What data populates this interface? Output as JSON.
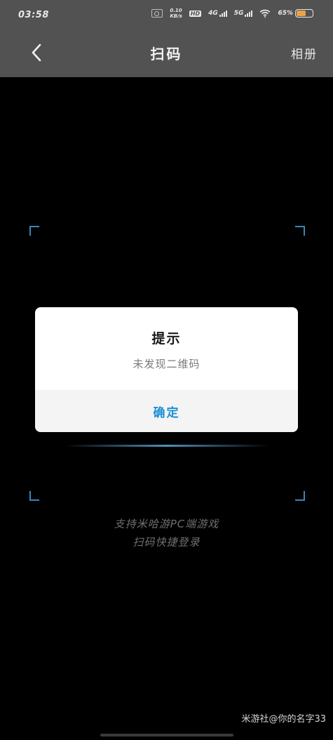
{
  "status_bar": {
    "time": "03:58",
    "net_speed_top": "0.10",
    "net_speed_bottom": "KB/s",
    "hd": "HD",
    "sim1": "4G",
    "sim2": "5G",
    "battery": "65%",
    "battery_level": 0.65
  },
  "header": {
    "title": "扫码",
    "album": "相册"
  },
  "hint": {
    "line1": "支持米哈游PC端游戏",
    "line2": "扫码快捷登录"
  },
  "dialog": {
    "title": "提示",
    "message": "未发现二维码",
    "confirm": "确定"
  },
  "watermark": "米游社@你的名字33",
  "colors": {
    "accent": "#1b8fd6",
    "frame": "#3a85b8",
    "bar": "#525252",
    "battery": "#e8a24a"
  }
}
